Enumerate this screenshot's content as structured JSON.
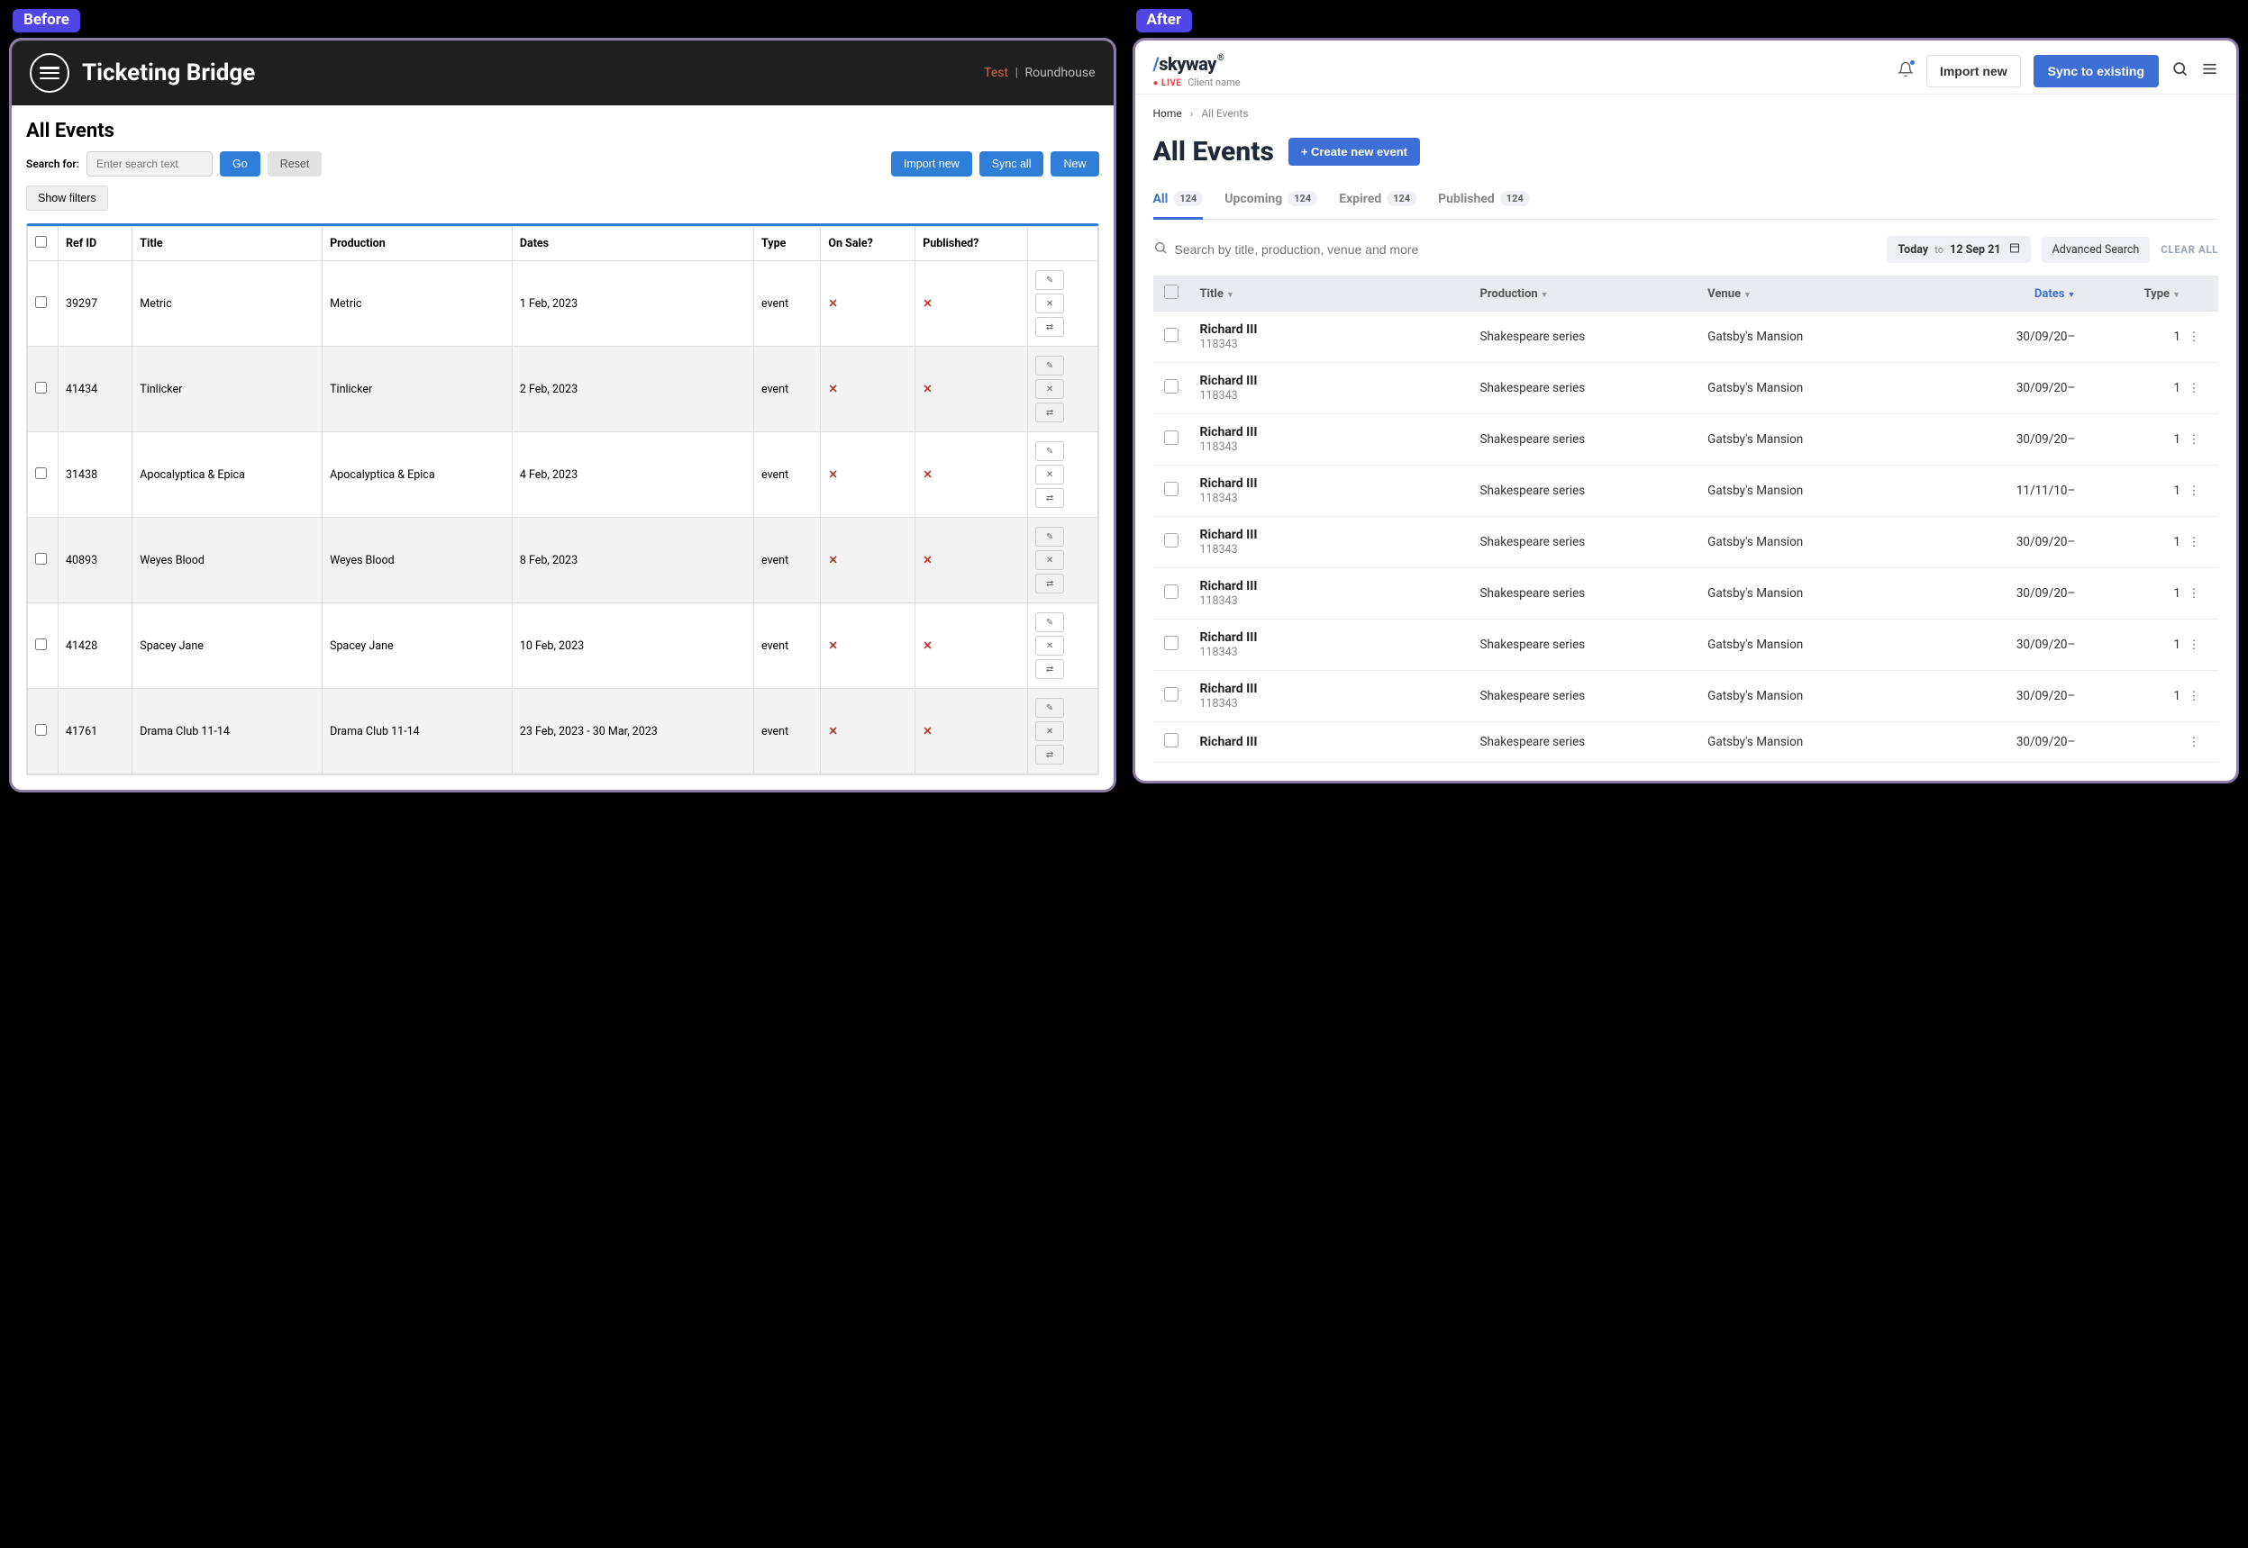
{
  "tags": {
    "before": "Before",
    "after": "After"
  },
  "before": {
    "brand": "Ticketing Bridge",
    "test_label": "Test",
    "pipe": "|",
    "venue": "Roundhouse",
    "heading": "All Events",
    "search_label": "Search for:",
    "search_placeholder": "Enter search text",
    "go": "Go",
    "reset": "Reset",
    "import_new": "Import new",
    "sync_all": "Sync all",
    "new": "New",
    "show_filters": "Show filters",
    "columns": {
      "ref_id": "Ref ID",
      "title": "Title",
      "production": "Production",
      "dates": "Dates",
      "type": "Type",
      "on_sale": "On Sale?",
      "published": "Published?"
    },
    "rows": [
      {
        "ref": "39297",
        "title": "Metric",
        "production": "Metric",
        "dates": "1 Feb, 2023",
        "type": "event"
      },
      {
        "ref": "41434",
        "title": "Tinlicker",
        "production": "Tinlicker",
        "dates": "2 Feb, 2023",
        "type": "event"
      },
      {
        "ref": "31438",
        "title": "Apocalyptica & Epica",
        "production": "Apocalyptica & Epica",
        "dates": "4 Feb, 2023",
        "type": "event"
      },
      {
        "ref": "40893",
        "title": "Weyes Blood",
        "production": "Weyes Blood",
        "dates": "8 Feb, 2023",
        "type": "event"
      },
      {
        "ref": "41428",
        "title": "Spacey Jane",
        "production": "Spacey Jane",
        "dates": "10 Feb, 2023",
        "type": "event"
      },
      {
        "ref": "41761",
        "title": "Drama Club 11-14",
        "production": "Drama Club 11-14",
        "dates": "23 Feb, 2023 - 30 Mar, 2023",
        "type": "event"
      }
    ]
  },
  "after": {
    "logo_prefix": "/",
    "logo_text": "skyway",
    "logo_sup": "®",
    "live": "LIVE",
    "client": "Client name",
    "import_new": "Import new",
    "sync_existing": "Sync to existing",
    "breadcrumb_home": "Home",
    "breadcrumb_sep": "›",
    "breadcrumb_current": "All Events",
    "heading": "All Events",
    "create_btn": "+  Create new event",
    "tabs": [
      {
        "label": "All",
        "count": "124",
        "active": true
      },
      {
        "label": "Upcoming",
        "count": "124",
        "active": false
      },
      {
        "label": "Expired",
        "count": "124",
        "active": false
      },
      {
        "label": "Published",
        "count": "124",
        "active": false
      }
    ],
    "search_placeholder": "Search by title, production, venue and more",
    "date_today": "Today",
    "date_to": "to",
    "date_until": "12 Sep 21",
    "advanced": "Advanced Search",
    "clear_all": "CLEAR ALL",
    "columns": {
      "title": "Title",
      "production": "Production",
      "venue": "Venue",
      "dates": "Dates",
      "type": "Type"
    },
    "rows": [
      {
        "title": "Richard III",
        "ref": "118343",
        "production": "Shakespeare series",
        "venue": "Gatsby's Mansion",
        "dates": "30/09/20–",
        "type": "1"
      },
      {
        "title": "Richard III",
        "ref": "118343",
        "production": "Shakespeare series",
        "venue": "Gatsby's Mansion",
        "dates": "30/09/20–",
        "type": "1"
      },
      {
        "title": "Richard III",
        "ref": "118343",
        "production": "Shakespeare series",
        "venue": "Gatsby's Mansion",
        "dates": "30/09/20–",
        "type": "1"
      },
      {
        "title": "Richard III",
        "ref": "118343",
        "production": "Shakespeare series",
        "venue": "Gatsby's Mansion",
        "dates": "11/11/10–",
        "type": "1"
      },
      {
        "title": "Richard III",
        "ref": "118343",
        "production": "Shakespeare series",
        "venue": "Gatsby's Mansion",
        "dates": "30/09/20–",
        "type": "1"
      },
      {
        "title": "Richard III",
        "ref": "118343",
        "production": "Shakespeare series",
        "venue": "Gatsby's Mansion",
        "dates": "30/09/20–",
        "type": "1"
      },
      {
        "title": "Richard III",
        "ref": "118343",
        "production": "Shakespeare series",
        "venue": "Gatsby's Mansion",
        "dates": "30/09/20–",
        "type": "1"
      },
      {
        "title": "Richard III",
        "ref": "118343",
        "production": "Shakespeare series",
        "venue": "Gatsby's Mansion",
        "dates": "30/09/20–",
        "type": "1"
      },
      {
        "title": "Richard III",
        "ref": "",
        "production": "Shakespeare series",
        "venue": "Gatsby's Mansion",
        "dates": "30/09/20–",
        "type": ""
      }
    ]
  }
}
